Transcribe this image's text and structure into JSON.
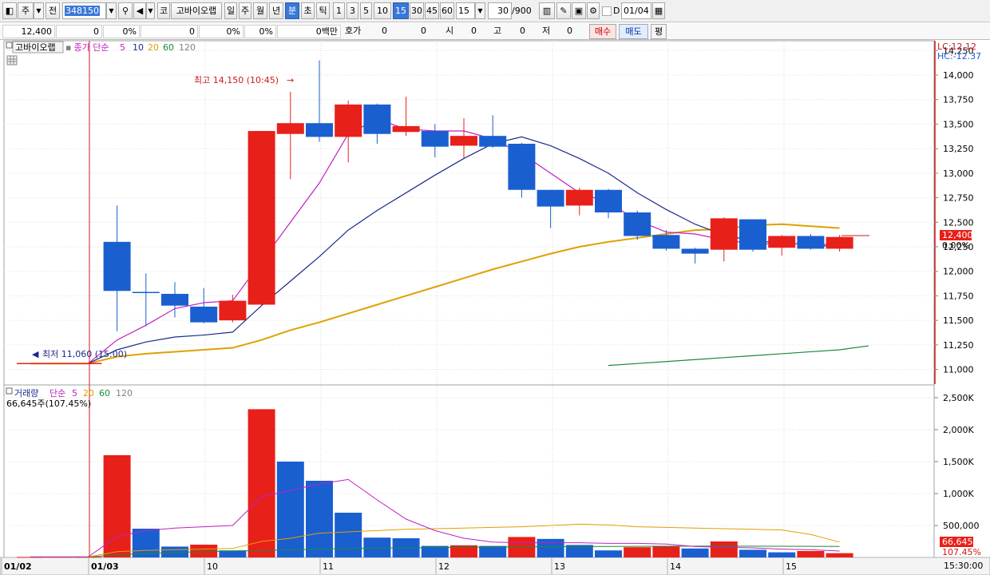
{
  "toolbar": {
    "type_label": "주",
    "prev_label": "전",
    "code_value": "348150",
    "market_label": "코",
    "stock_name": "고바이오랩",
    "periods": [
      "일",
      "주",
      "월",
      "년",
      "분",
      "초",
      "틱"
    ],
    "selected_period": "분",
    "intervals": [
      "1",
      "3",
      "5",
      "10",
      "15",
      "30",
      "45",
      "60"
    ],
    "selected_interval": "15",
    "interval_input": "15",
    "count_value": "30",
    "count_max": "/900",
    "d_label": "D",
    "date_value": "01/04"
  },
  "quote": {
    "price": "12,400",
    "change": "0",
    "change_pct": "0%",
    "volume": "0",
    "vol_pct": "0%",
    "vol_pct2": "0%",
    "amount": "0백만",
    "hoga_label": "호가",
    "hoga_val1": "0",
    "hoga_val2": "0",
    "open_label": "시",
    "open_val": "0",
    "high_label": "고",
    "high_val": "0",
    "low_label": "저",
    "low_val": "0",
    "buy_label": "매수",
    "sell_label": "매도",
    "even_label": "평"
  },
  "price_panel": {
    "title": "고바이오랩",
    "legend_prefix": "종가 단순",
    "ma_periods": [
      "5",
      "10",
      "20",
      "60",
      "120"
    ],
    "ma_colors": [
      "#c020c0",
      "#1a2a8a",
      "#e0a000",
      "#1a8a3a",
      "#808080"
    ],
    "lc_label": "LC:12.12",
    "hc_label": "HC:-12.37",
    "high_annotation": "최고 14,150 (10:45)",
    "low_annotation": "최저 11,060 (15:00)",
    "current_price_tag": "12,400",
    "current_pct_tag": "0.00%"
  },
  "volume_panel": {
    "title": "거래량",
    "legend_prefix": "단순",
    "ma_periods": [
      "5",
      "20",
      "60",
      "120"
    ],
    "current_label": "66,645주(107.45%)",
    "current_tag": "66,645",
    "current_pct_tag": "107.45%"
  },
  "x_axis": {
    "labels": [
      "01/02",
      "01/03",
      "10",
      "11",
      "12",
      "13",
      "14",
      "15"
    ],
    "time_label": "15:30:00"
  },
  "colors": {
    "up": "#e8201a",
    "down": "#1a5fd0",
    "ma5": "#c020c0",
    "ma10": "#1a2a8a",
    "ma20": "#e0a000",
    "ma60": "#1a8a3a",
    "highlight_line": "#d01818"
  },
  "chart_data": [
    {
      "type": "candlestick",
      "title": "",
      "ylim": [
        10850,
        14350
      ],
      "y_ticks": [
        "11,000",
        "11,250",
        "11,500",
        "11,750",
        "12,000",
        "12,250",
        "12,500",
        "12,750",
        "13,000",
        "13,250",
        "13,500",
        "13,750",
        "14,000",
        "14,250"
      ],
      "candles": [
        {
          "o": 11060,
          "c": 11060,
          "h": 11060,
          "l": 11060
        },
        {
          "o": 11060,
          "c": 11060,
          "h": 11060,
          "l": 11060
        },
        {
          "o": 11060,
          "c": 11060,
          "h": 11060,
          "l": 11060
        },
        {
          "o": 12300,
          "c": 11800,
          "h": 12670,
          "l": 11390
        },
        {
          "o": 11790,
          "c": 11780,
          "h": 11980,
          "l": 11440
        },
        {
          "o": 11770,
          "c": 11650,
          "h": 11890,
          "l": 11530
        },
        {
          "o": 11640,
          "c": 11480,
          "h": 11830,
          "l": 11470
        },
        {
          "o": 11500,
          "c": 11700,
          "h": 11760,
          "l": 11480
        },
        {
          "o": 11660,
          "c": 13430,
          "h": 13430,
          "l": 11650
        },
        {
          "o": 13400,
          "c": 13510,
          "h": 13830,
          "l": 12940
        },
        {
          "o": 13510,
          "c": 13370,
          "h": 14150,
          "l": 13320
        },
        {
          "o": 13370,
          "c": 13700,
          "h": 13740,
          "l": 13110
        },
        {
          "o": 13700,
          "c": 13400,
          "h": 13710,
          "l": 13300
        },
        {
          "o": 13420,
          "c": 13480,
          "h": 13780,
          "l": 13380
        },
        {
          "o": 13430,
          "c": 13270,
          "h": 13500,
          "l": 13160
        },
        {
          "o": 13280,
          "c": 13380,
          "h": 13560,
          "l": 13150
        },
        {
          "o": 13380,
          "c": 13270,
          "h": 13590,
          "l": 13260
        },
        {
          "o": 13300,
          "c": 12830,
          "h": 13310,
          "l": 12750
        },
        {
          "o": 12830,
          "c": 12660,
          "h": 12830,
          "l": 12440
        },
        {
          "o": 12670,
          "c": 12830,
          "h": 12850,
          "l": 12570
        },
        {
          "o": 12830,
          "c": 12600,
          "h": 12840,
          "l": 12540
        },
        {
          "o": 12600,
          "c": 12360,
          "h": 12620,
          "l": 12320
        },
        {
          "o": 12370,
          "c": 12230,
          "h": 12420,
          "l": 12210
        },
        {
          "o": 12230,
          "c": 12180,
          "h": 12240,
          "l": 12080
        },
        {
          "o": 12220,
          "c": 12540,
          "h": 12550,
          "l": 12100
        },
        {
          "o": 12530,
          "c": 12220,
          "h": 12530,
          "l": 12200
        },
        {
          "o": 12240,
          "c": 12360,
          "h": 12370,
          "l": 12160
        },
        {
          "o": 12360,
          "c": 12230,
          "h": 12380,
          "l": 12220
        },
        {
          "o": 12230,
          "c": 12350,
          "h": 12370,
          "l": 12200
        }
      ],
      "ma5": [
        11060,
        11060,
        11060,
        11300,
        11450,
        11620,
        11680,
        11700,
        12100,
        12500,
        12900,
        13400,
        13550,
        13450,
        13430,
        13430,
        13350,
        13200,
        13000,
        12800,
        12700,
        12520,
        12400,
        12380,
        12320,
        12280,
        12280,
        12280,
        12270
      ],
      "ma10": [
        11060,
        11060,
        11060,
        11200,
        11280,
        11330,
        11350,
        11380,
        11650,
        11900,
        12150,
        12420,
        12620,
        12800,
        12980,
        13150,
        13300,
        13370,
        13280,
        13150,
        13000,
        12800,
        12630,
        12480,
        12370,
        12310,
        12290,
        12270,
        12250
      ],
      "ma20": [
        11060,
        11060,
        11060,
        11130,
        11160,
        11180,
        11200,
        11220,
        11300,
        11400,
        11480,
        11570,
        11660,
        11750,
        11840,
        11930,
        12020,
        12100,
        12180,
        12250,
        12300,
        12340,
        12380,
        12420,
        12430,
        12470,
        12480,
        12460,
        12440
      ],
      "ma60": [
        11040,
        11060,
        11080,
        11100,
        11120,
        11140,
        11160,
        11180,
        11200,
        11240
      ],
      "ma60_start_index": 20
    },
    {
      "type": "bar",
      "title": "",
      "ylim": [
        0,
        2600000
      ],
      "y_ticks": [
        "500,000",
        "1,000,000",
        "1,500,000",
        "2,000,000",
        "2,500,000"
      ],
      "y_tick_labels": [
        "500,000",
        "1,000K",
        "1,500K",
        "2,000K",
        "2,500K"
      ],
      "values": [
        8000,
        9000,
        9000,
        1600000,
        450000,
        170000,
        200000,
        110000,
        2320000,
        1500000,
        1200000,
        700000,
        310000,
        300000,
        180000,
        190000,
        180000,
        320000,
        290000,
        195000,
        110000,
        160000,
        180000,
        140000,
        250000,
        120000,
        80000,
        100000,
        66645
      ],
      "colors_up": [
        true,
        true,
        true,
        true,
        false,
        false,
        true,
        false,
        true,
        false,
        false,
        false,
        false,
        false,
        false,
        true,
        false,
        true,
        false,
        false,
        false,
        true,
        true,
        false,
        true,
        false,
        false,
        true,
        true
      ],
      "ma5": [
        8000,
        8000,
        8000,
        330000,
        420000,
        460000,
        480000,
        500000,
        950000,
        1050000,
        1150000,
        1220000,
        900000,
        600000,
        420000,
        300000,
        240000,
        230000,
        230000,
        230000,
        220000,
        220000,
        210000,
        170000,
        160000,
        150000,
        130000,
        120000,
        100000
      ],
      "ma20": [
        8000,
        8000,
        8000,
        90000,
        110000,
        120000,
        130000,
        140000,
        250000,
        300000,
        380000,
        400000,
        420000,
        440000,
        450000,
        460000,
        470000,
        480000,
        500000,
        520000,
        510000,
        480000,
        470000,
        460000,
        450000,
        440000,
        430000,
        360000,
        240000
      ],
      "ma60": [
        8000,
        8000,
        8000,
        40000,
        60000,
        80000,
        90000,
        100000,
        110000,
        120000,
        130000,
        140000,
        145000,
        150000,
        155000,
        160000,
        162000,
        165000,
        168000,
        170000,
        172000,
        174000,
        175000,
        176000,
        177000,
        176000,
        175000,
        174000,
        172000
      ]
    }
  ]
}
